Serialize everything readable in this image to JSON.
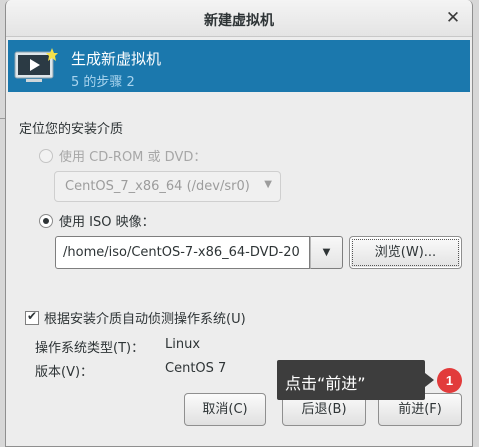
{
  "window": {
    "title": "新建虚拟机",
    "close_glyph": "✕"
  },
  "banner": {
    "title": "生成新虚拟机",
    "step": "5 的步骤 2",
    "icon": "monitor-play-icon"
  },
  "install_media": {
    "section_label": "定位您的安装介质",
    "cdrom_option": {
      "label": "使用  CD-ROM 或  DVD：",
      "selected": false,
      "enabled": false
    },
    "cdrom_device": {
      "value": "CentOS_7_x86_64 (/dev/sr0)",
      "arrow": "▼"
    },
    "iso_option": {
      "label": "使用  ISO 映像：",
      "selected": true,
      "enabled": true
    },
    "iso_path": {
      "value": "/home/iso/CentOS-7-x86_64-DVD-20",
      "arrow": "▼"
    },
    "browse_label": "浏览(W)..."
  },
  "auto_detect": {
    "checked": true,
    "label": "根据安装介质自动侦测操作系统(U)"
  },
  "os_info": {
    "type_label": "操作系统类型(T)：",
    "type_value": "Linux",
    "version_label": "版本(V)：",
    "version_value": "CentOS 7"
  },
  "buttons": {
    "cancel": "取消(C)",
    "back": "后退(B)",
    "forward": "前进(F)"
  },
  "annotation": {
    "tooltip": "点击“前进”",
    "badge": "1"
  },
  "colors": {
    "banner": "#1b78ad",
    "dialog_bg": "#ededed",
    "badge": "#e23b3b",
    "tooltip_bg": "#3d3d3d"
  }
}
